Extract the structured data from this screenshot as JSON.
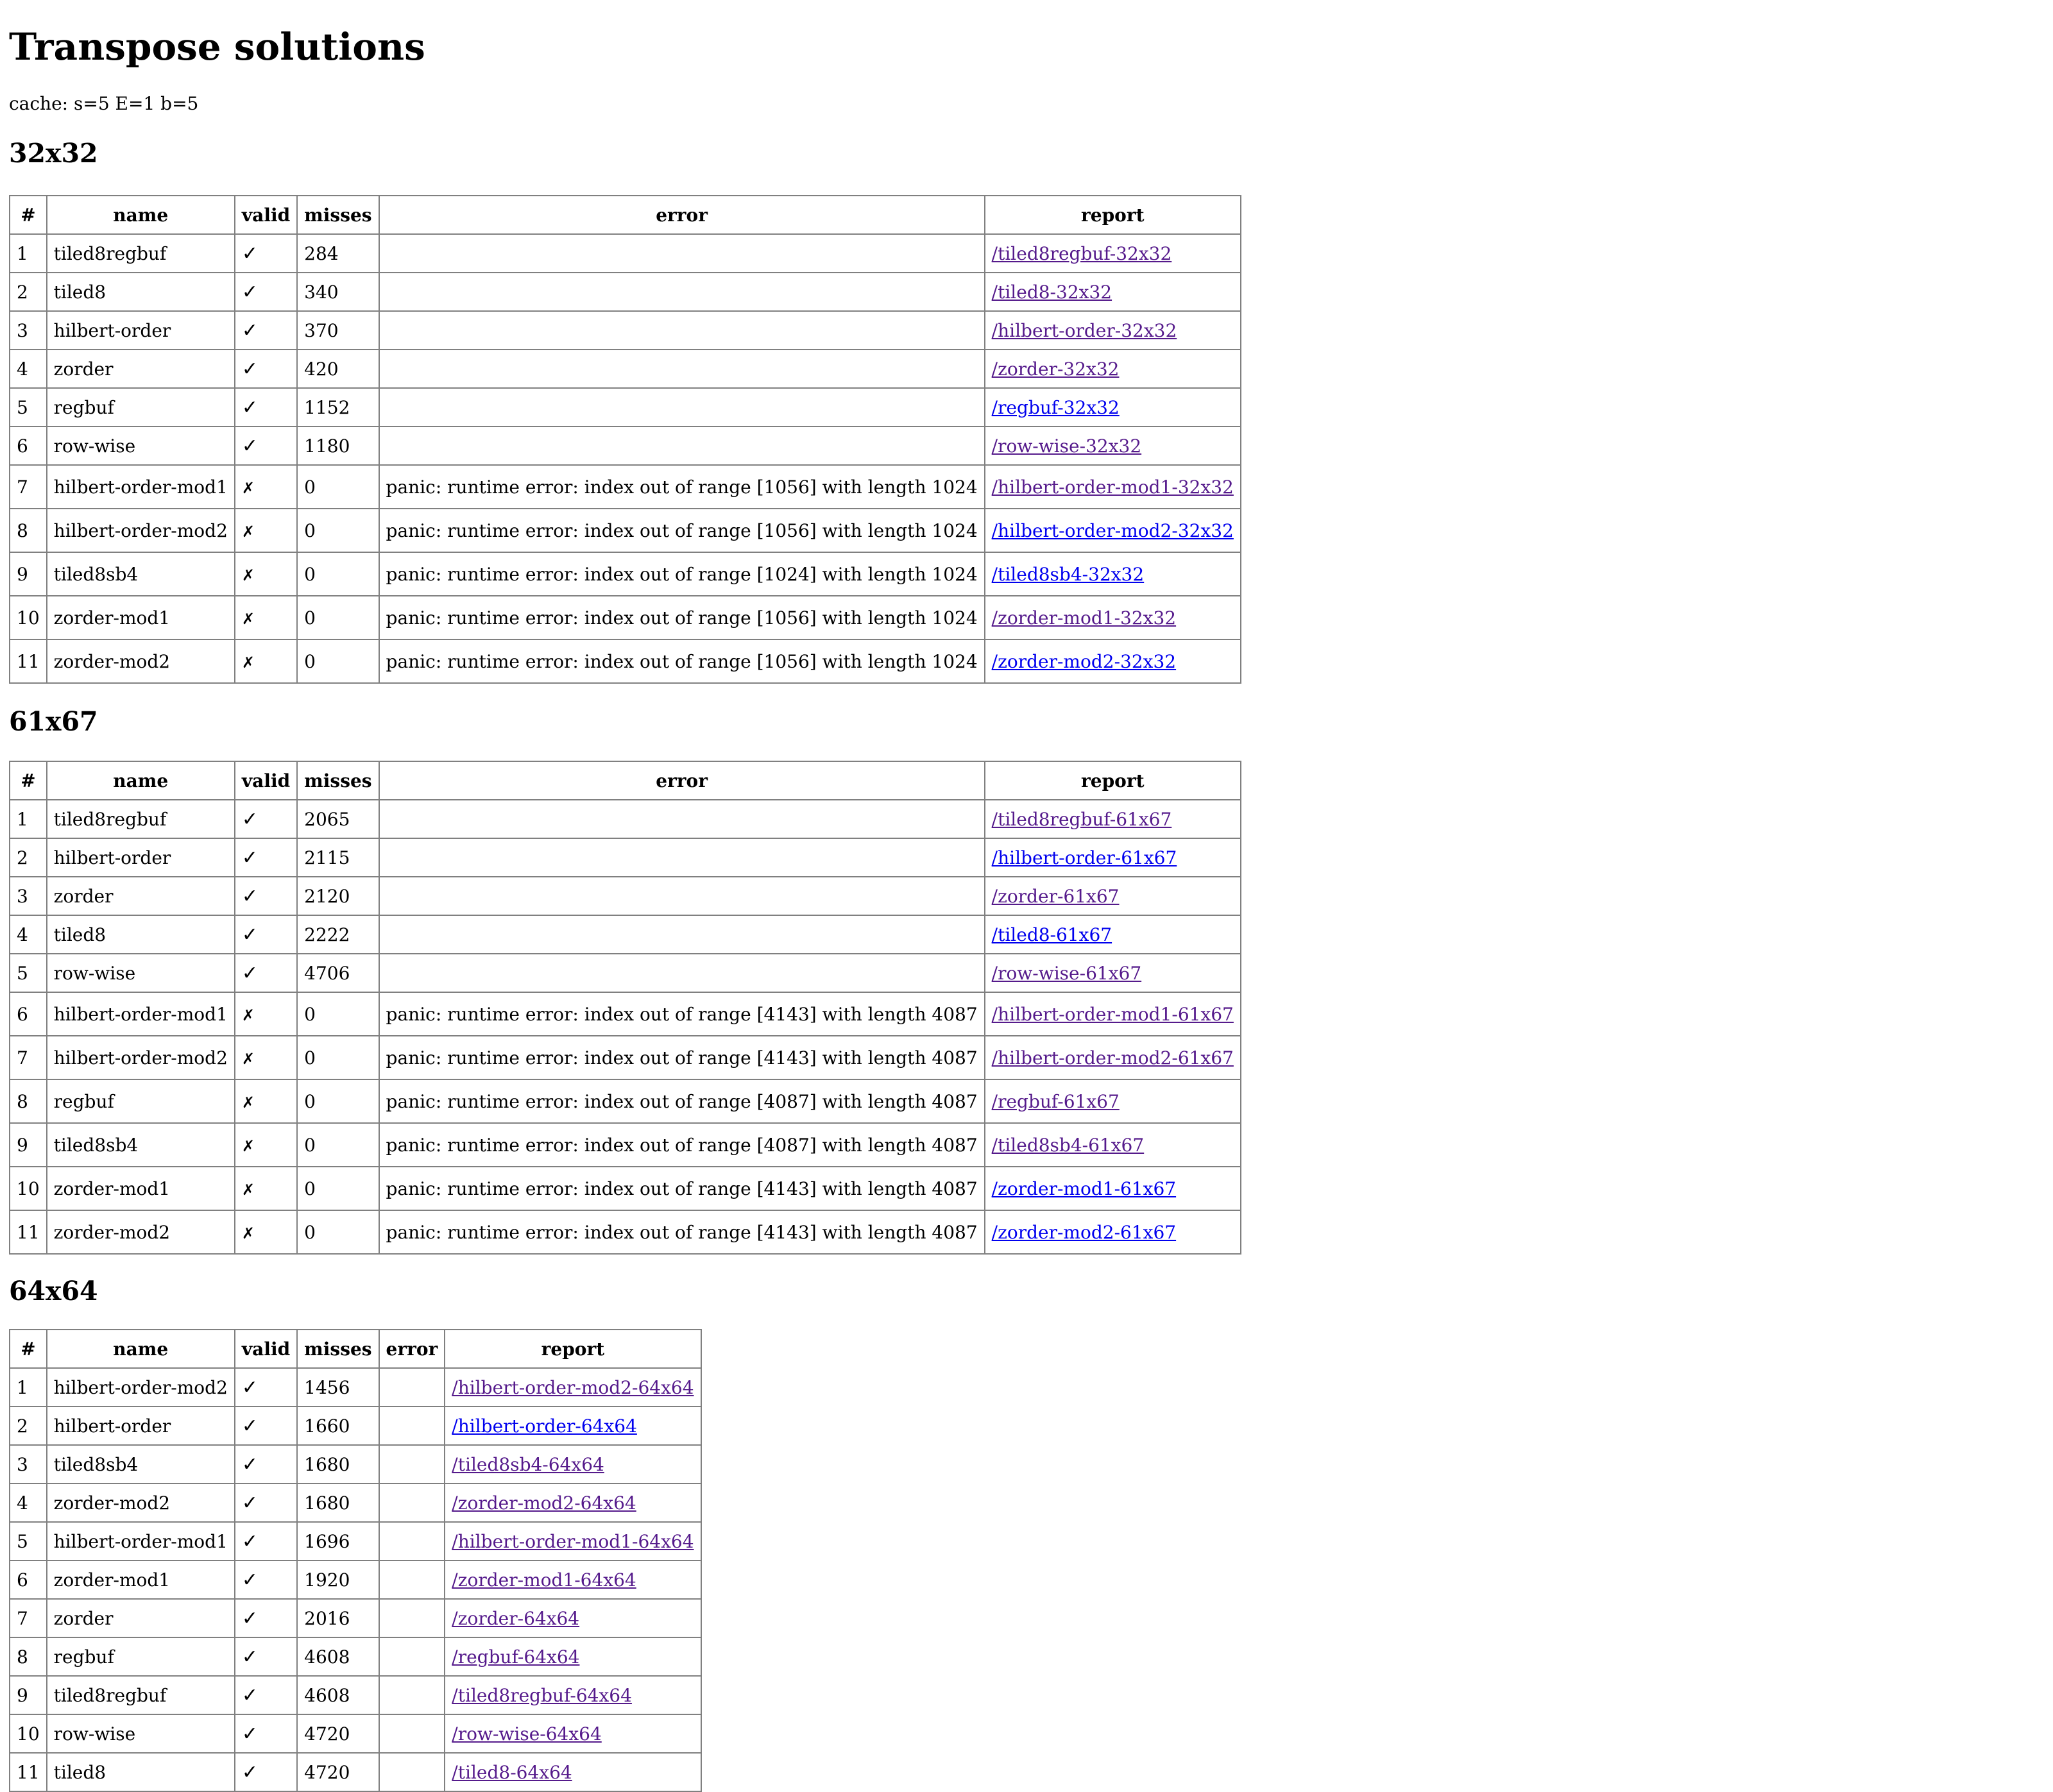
{
  "title": "Transpose solutions",
  "cache": "cache: s=5 E=1 b=5",
  "columns": [
    "#",
    "name",
    "valid",
    "misses",
    "error",
    "report"
  ],
  "marks": {
    "valid": "✓",
    "invalid": "✗"
  },
  "sections": [
    {
      "title": "32x32",
      "rows": [
        {
          "n": "1",
          "name": "tiled8regbuf",
          "valid": true,
          "misses": "284",
          "error": "",
          "report": "/tiled8regbuf-32x32"
        },
        {
          "n": "2",
          "name": "tiled8",
          "valid": true,
          "misses": "340",
          "error": "",
          "report": "/tiled8-32x32"
        },
        {
          "n": "3",
          "name": "hilbert-order",
          "valid": true,
          "misses": "370",
          "error": "",
          "report": "/hilbert-order-32x32"
        },
        {
          "n": "4",
          "name": "zorder",
          "valid": true,
          "misses": "420",
          "error": "",
          "report": "/zorder-32x32"
        },
        {
          "n": "5",
          "name": "regbuf",
          "valid": true,
          "misses": "1152",
          "error": "",
          "report": "/regbuf-32x32"
        },
        {
          "n": "6",
          "name": "row-wise",
          "valid": true,
          "misses": "1180",
          "error": "",
          "report": "/row-wise-32x32"
        },
        {
          "n": "7",
          "name": "hilbert-order-mod1",
          "valid": false,
          "misses": "0",
          "error": "panic: runtime error: index out of range [1056] with length 1024",
          "report": "/hilbert-order-mod1-32x32"
        },
        {
          "n": "8",
          "name": "hilbert-order-mod2",
          "valid": false,
          "misses": "0",
          "error": "panic: runtime error: index out of range [1056] with length 1024",
          "report": "/hilbert-order-mod2-32x32"
        },
        {
          "n": "9",
          "name": "tiled8sb4",
          "valid": false,
          "misses": "0",
          "error": "panic: runtime error: index out of range [1024] with length 1024",
          "report": "/tiled8sb4-32x32"
        },
        {
          "n": "10",
          "name": "zorder-mod1",
          "valid": false,
          "misses": "0",
          "error": "panic: runtime error: index out of range [1056] with length 1024",
          "report": "/zorder-mod1-32x32"
        },
        {
          "n": "11",
          "name": "zorder-mod2",
          "valid": false,
          "misses": "0",
          "error": "panic: runtime error: index out of range [1056] with length 1024",
          "report": "/zorder-mod2-32x32"
        }
      ]
    },
    {
      "title": "61x67",
      "rows": [
        {
          "n": "1",
          "name": "tiled8regbuf",
          "valid": true,
          "misses": "2065",
          "error": "",
          "report": "/tiled8regbuf-61x67"
        },
        {
          "n": "2",
          "name": "hilbert-order",
          "valid": true,
          "misses": "2115",
          "error": "",
          "report": "/hilbert-order-61x67"
        },
        {
          "n": "3",
          "name": "zorder",
          "valid": true,
          "misses": "2120",
          "error": "",
          "report": "/zorder-61x67"
        },
        {
          "n": "4",
          "name": "tiled8",
          "valid": true,
          "misses": "2222",
          "error": "",
          "report": "/tiled8-61x67"
        },
        {
          "n": "5",
          "name": "row-wise",
          "valid": true,
          "misses": "4706",
          "error": "",
          "report": "/row-wise-61x67"
        },
        {
          "n": "6",
          "name": "hilbert-order-mod1",
          "valid": false,
          "misses": "0",
          "error": "panic: runtime error: index out of range [4143] with length 4087",
          "report": "/hilbert-order-mod1-61x67"
        },
        {
          "n": "7",
          "name": "hilbert-order-mod2",
          "valid": false,
          "misses": "0",
          "error": "panic: runtime error: index out of range [4143] with length 4087",
          "report": "/hilbert-order-mod2-61x67"
        },
        {
          "n": "8",
          "name": "regbuf",
          "valid": false,
          "misses": "0",
          "error": "panic: runtime error: index out of range [4087] with length 4087",
          "report": "/regbuf-61x67"
        },
        {
          "n": "9",
          "name": "tiled8sb4",
          "valid": false,
          "misses": "0",
          "error": "panic: runtime error: index out of range [4087] with length 4087",
          "report": "/tiled8sb4-61x67"
        },
        {
          "n": "10",
          "name": "zorder-mod1",
          "valid": false,
          "misses": "0",
          "error": "panic: runtime error: index out of range [4143] with length 4087",
          "report": "/zorder-mod1-61x67"
        },
        {
          "n": "11",
          "name": "zorder-mod2",
          "valid": false,
          "misses": "0",
          "error": "panic: runtime error: index out of range [4143] with length 4087",
          "report": "/zorder-mod2-61x67"
        }
      ]
    },
    {
      "title": "64x64",
      "rows": [
        {
          "n": "1",
          "name": "hilbert-order-mod2",
          "valid": true,
          "misses": "1456",
          "error": "",
          "report": "/hilbert-order-mod2-64x64"
        },
        {
          "n": "2",
          "name": "hilbert-order",
          "valid": true,
          "misses": "1660",
          "error": "",
          "report": "/hilbert-order-64x64"
        },
        {
          "n": "3",
          "name": "tiled8sb4",
          "valid": true,
          "misses": "1680",
          "error": "",
          "report": "/tiled8sb4-64x64"
        },
        {
          "n": "4",
          "name": "zorder-mod2",
          "valid": true,
          "misses": "1680",
          "error": "",
          "report": "/zorder-mod2-64x64"
        },
        {
          "n": "5",
          "name": "hilbert-order-mod1",
          "valid": true,
          "misses": "1696",
          "error": "",
          "report": "/hilbert-order-mod1-64x64"
        },
        {
          "n": "6",
          "name": "zorder-mod1",
          "valid": true,
          "misses": "1920",
          "error": "",
          "report": "/zorder-mod1-64x64"
        },
        {
          "n": "7",
          "name": "zorder",
          "valid": true,
          "misses": "2016",
          "error": "",
          "report": "/zorder-64x64"
        },
        {
          "n": "8",
          "name": "regbuf",
          "valid": true,
          "misses": "4608",
          "error": "",
          "report": "/regbuf-64x64"
        },
        {
          "n": "9",
          "name": "tiled8regbuf",
          "valid": true,
          "misses": "4608",
          "error": "",
          "report": "/tiled8regbuf-64x64"
        },
        {
          "n": "10",
          "name": "row-wise",
          "valid": true,
          "misses": "4720",
          "error": "",
          "report": "/row-wise-64x64"
        },
        {
          "n": "11",
          "name": "tiled8",
          "valid": true,
          "misses": "4720",
          "error": "",
          "report": "/tiled8-64x64"
        }
      ]
    }
  ]
}
